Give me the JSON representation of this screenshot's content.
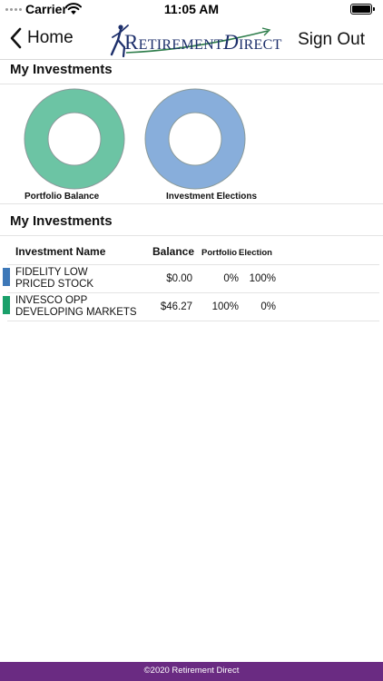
{
  "status_bar": {
    "carrier": "Carrier",
    "time": "11:05 AM",
    "icons": [
      "signal-dots-icon",
      "wifi-icon",
      "battery-icon"
    ]
  },
  "nav": {
    "back_label": "Home",
    "back_icon": "chevron-left-icon",
    "logo_text": {
      "r": "R",
      "etirement": "ETIREMENT",
      "d": "D",
      "irect": "IRECT"
    },
    "sign_out_label": "Sign Out"
  },
  "sections": {
    "top_title": "My Investments",
    "table_title": "My Investments"
  },
  "charts": {
    "portfolio_label": "Portfolio Balance",
    "elections_label": "Investment Elections"
  },
  "chart_data": [
    {
      "type": "pie",
      "title": "Portfolio Balance",
      "categories": [
        "FIDELITY LOW PRICED STOCK",
        "INVESCO OPP DEVELOPING MARKETS"
      ],
      "values": [
        0,
        100
      ],
      "colors": [
        "#3d78b8",
        "#6cc4a4"
      ]
    },
    {
      "type": "pie",
      "title": "Investment Elections",
      "categories": [
        "FIDELITY LOW PRICED STOCK",
        "INVESCO OPP DEVELOPING MARKETS"
      ],
      "values": [
        100,
        0
      ],
      "colors": [
        "#88aedb",
        "#6cc4a4"
      ]
    }
  ],
  "table": {
    "headers": {
      "name": "Investment Name",
      "balance": "Balance",
      "portfolio": "Portfolio",
      "election": "Election"
    },
    "rows": [
      {
        "name_line1": "FIDELITY LOW",
        "name_line2": "PRICED STOCK",
        "balance": "$0.00",
        "portfolio": "0%",
        "election": "100%",
        "color": "#3d78b8"
      },
      {
        "name_line1": "INVESCO OPP",
        "name_line2": "DEVELOPING MARKETS",
        "balance": "$46.27",
        "portfolio": "100%",
        "election": "0%",
        "color": "#1aa06a"
      }
    ]
  },
  "footer": {
    "text": "©2020 Retirement Direct",
    "color": "#6a2b82"
  }
}
